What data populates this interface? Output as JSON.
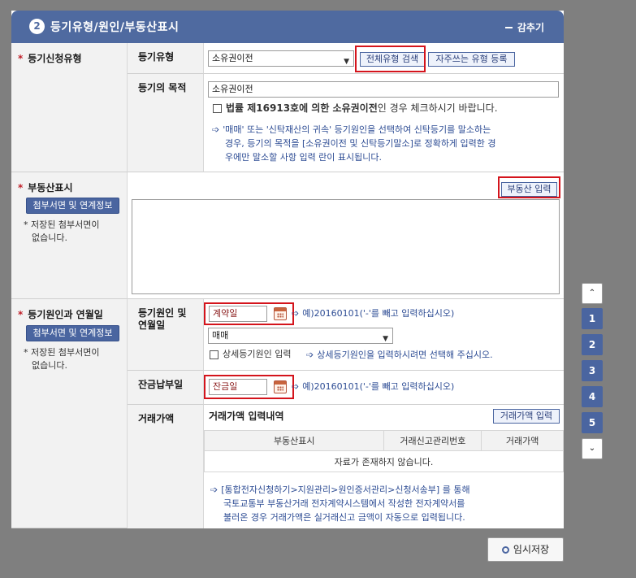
{
  "section": {
    "number": "2",
    "title": "등기유형/원인/부동산표시",
    "collapse_label": "감추기"
  },
  "registration_type": {
    "category": "등기신청유형",
    "type_label": "등기유형",
    "type_value": "소유권이전",
    "search_button": "전체유형 검색",
    "favorites_button": "자주쓰는 유형 등록",
    "purpose_label": "등기의 목적",
    "purpose_value": "소유권이전",
    "checkbox_label_bold": "법률 제16913호에 의한 소유권이전",
    "checkbox_label_rest": "인 경우 체크하시기 바랍니다.",
    "info_lines": [
      "'매매' 또는 '신탁재산의 귀속' 등기원인을 선택하여 신탁등기를 말소하는",
      "경우, 등기의 목적을 [소유권이전 및 신탁등기말소]로 정확하게 입력한 경",
      "우에만 말소할 사항 입력 란이 표시됩니다."
    ]
  },
  "property": {
    "category": "부동산표시",
    "attach_button": "첨부서면 및 연계정보",
    "no_attach_text": [
      "저장된 첨부서면이",
      "없습니다."
    ],
    "input_button": "부동산 입력"
  },
  "cause": {
    "category": "등기원인과 연월일",
    "attach_button": "첨부서면 및 연계정보",
    "no_attach_text": [
      "저장된 첨부서면이",
      "없습니다."
    ],
    "cause_label": [
      "등기원인 및",
      "연월일"
    ],
    "date_placeholder": "계약일",
    "date_hint": "예)20160101('-'를 빼고 입력하십시오)",
    "cause_select": "매매",
    "detail_checkbox": "상세등기원인 입력",
    "detail_hint": "상세등기원인을 입력하시려면 선택해 주십시오.",
    "balance_label": "잔금납부일",
    "balance_placeholder": "잔금일",
    "balance_hint": "예)20160101('-'를 빼고 입력하십시오)",
    "price_label": "거래가액",
    "price_subtitle": "거래가액 입력내역",
    "price_button": "거래가액 입력",
    "table_headers": [
      "부동산표시",
      "거래신고관리번호",
      "거래가액"
    ],
    "table_empty": "자료가 존재하지 않습니다.",
    "price_info": [
      "[통합전자신청하기>지원관리>원인증서관리>신청서송부] 를 통해",
      "국토교통부 부동산거래 전자계약시스템에서 작성한 전자계약서를",
      "불러온 경우 거래가액은 실거래신고 금액이 자동으로 입력됩니다."
    ]
  },
  "side_nav": {
    "up": "⌃",
    "items": [
      "1",
      "2",
      "3",
      "4",
      "5"
    ],
    "down": "⌄"
  },
  "save_button": "임시저장"
}
